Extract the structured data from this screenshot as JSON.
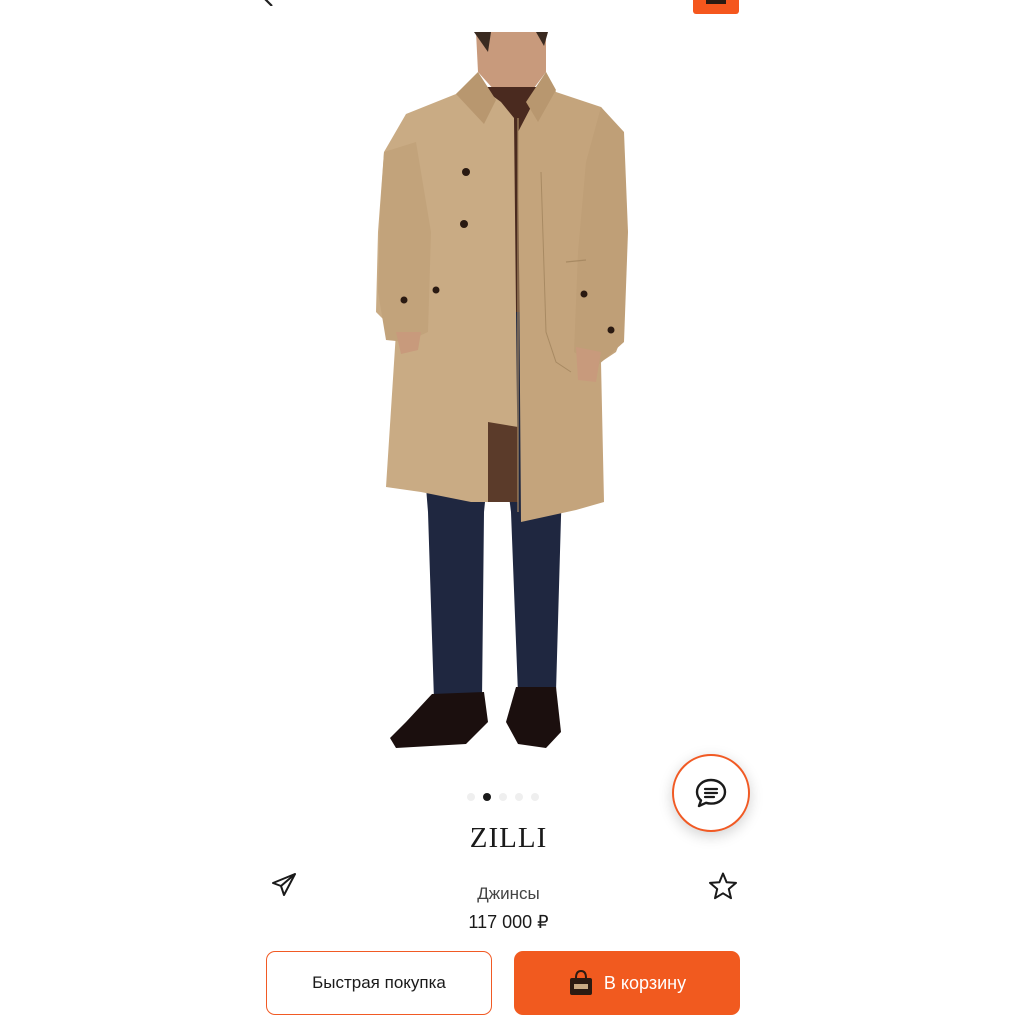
{
  "product": {
    "brand": "ZILLI",
    "name": "Джинсы",
    "price": "117 000 ₽"
  },
  "gallery": {
    "total_images": 5,
    "active_index": 1
  },
  "actions": {
    "quick_buy_label": "Быстрая покупка",
    "add_to_cart_label": "В корзину"
  },
  "icons": {
    "back": "chevron-left-icon",
    "cart_top": "cart-icon",
    "chat": "chat-bubble-icon",
    "share": "paper-plane-icon",
    "favorite": "star-outline-icon",
    "bag": "shopping-bag-icon"
  },
  "colors": {
    "accent": "#f15a24",
    "text": "#1a1a1a",
    "muted_text": "#444444",
    "background": "#ffffff"
  }
}
